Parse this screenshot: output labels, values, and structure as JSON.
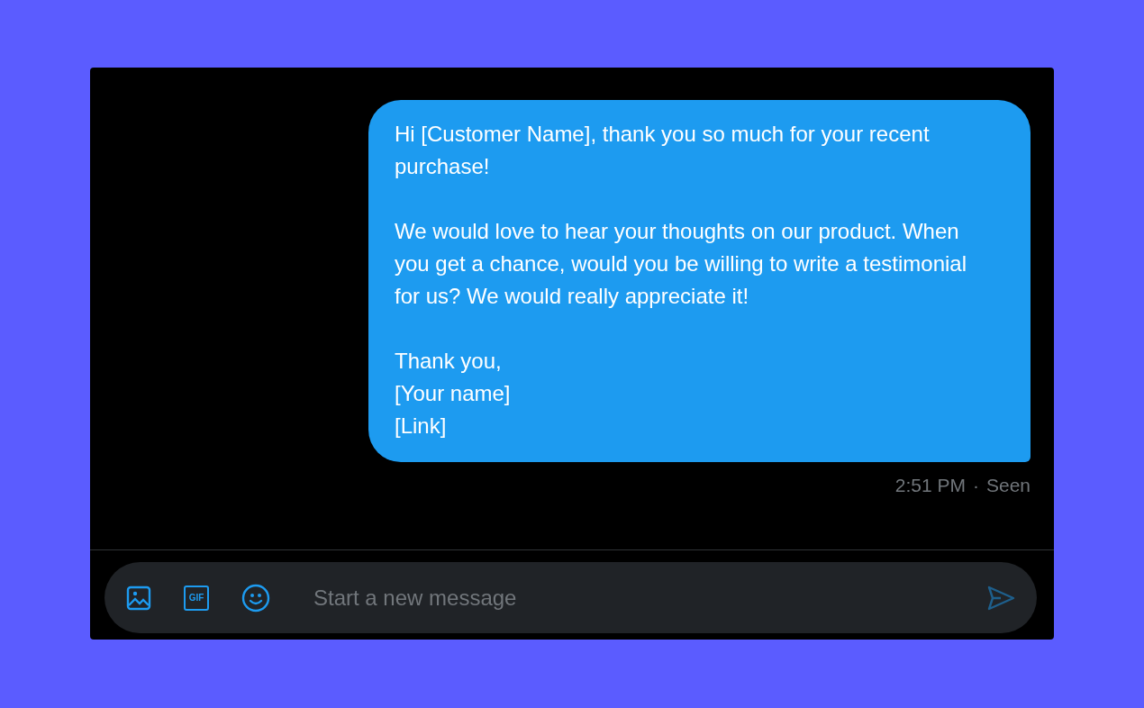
{
  "message": {
    "paragraphs": [
      [
        "Hi [Customer Name], thank you so much for your recent purchase!"
      ],
      [
        "We would love to hear your thoughts on our product. When you get a chance, would you be willing to write a testimonial for us? We would really appreciate it!"
      ],
      [
        "Thank you,",
        "[Your name]",
        "[Link]"
      ]
    ],
    "time": "2:51 PM",
    "separator": "·",
    "status": "Seen"
  },
  "composer": {
    "gif_label": "GIF",
    "placeholder": "Start a new message",
    "send_disabled": true
  }
}
